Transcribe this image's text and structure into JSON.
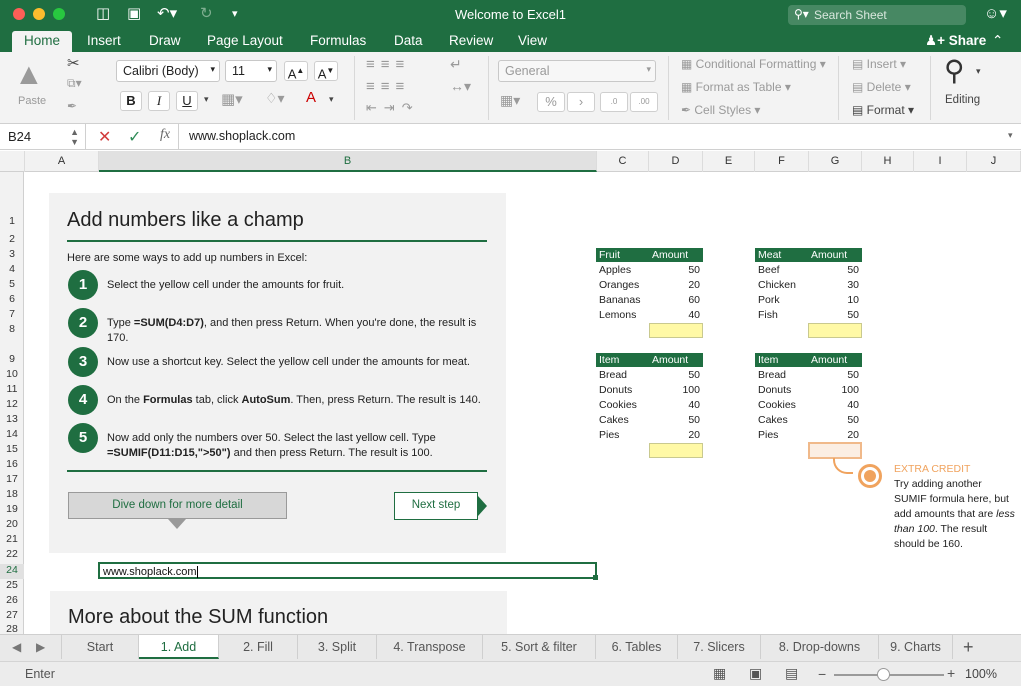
{
  "window": {
    "title": "Welcome to Excel1",
    "search_placeholder": "Search Sheet"
  },
  "ribbon_tabs": [
    "Home",
    "Insert",
    "Draw",
    "Page Layout",
    "Formulas",
    "Data",
    "Review",
    "View"
  ],
  "share_label": "Share",
  "ribbon": {
    "paste_label": "Paste",
    "font_name": "Calibri (Body)",
    "font_size": "11",
    "number_format": "General",
    "conditional_formatting": "Conditional Formatting",
    "format_as_table": "Format as Table",
    "cell_styles": "Cell Styles",
    "insert": "Insert",
    "delete": "Delete",
    "format": "Format",
    "editing": "Editing",
    "bold": "B",
    "italic": "I",
    "underline": "U",
    "percent": "%",
    "fx": "fx"
  },
  "formula_bar": {
    "name_box": "B24",
    "content": "www.shoplack.com"
  },
  "columns": [
    "A",
    "B",
    "C",
    "D",
    "E",
    "F",
    "G",
    "H",
    "I",
    "J"
  ],
  "rows": [
    "1",
    "2",
    "3",
    "4",
    "5",
    "6",
    "7",
    "8",
    "9",
    "10",
    "11",
    "12",
    "13",
    "14",
    "15",
    "16",
    "17",
    "18",
    "19",
    "20",
    "21",
    "22",
    "23",
    "24",
    "25",
    "26",
    "27",
    "28"
  ],
  "lesson": {
    "title": "Add numbers like a champ",
    "intro": "Here are some ways to add up numbers in Excel:",
    "steps": [
      {
        "num": "1",
        "text": "Select the yellow cell under the amounts for fruit."
      },
      {
        "num": "2",
        "pre": "Type ",
        "bold": "=SUM(D4:D7)",
        "post": ", and then press Return. When you're done, the result is 170."
      },
      {
        "num": "3",
        "text": "Now use a shortcut key. Select the yellow cell under the amounts for meat."
      },
      {
        "num": "4",
        "pre": "On the ",
        "bold": "Formulas",
        "mid": " tab, click ",
        "bold2": "AutoSum",
        "post": ". Then, press Return. The result is 140."
      },
      {
        "num": "5",
        "pre": "Now add only the numbers over 50. Select the last yellow cell. Type ",
        "bold": "=SUMIF(D11:D15,\">50\")",
        "post": " and then press Return. The result is 100."
      }
    ],
    "dive_button": "Dive down for more detail",
    "next_button": "Next step",
    "more_title": "More about the SUM function"
  },
  "active_cell_value": "www.shoplack.com",
  "tables": [
    {
      "h1": "Fruit",
      "h2": "Amount",
      "rows": [
        [
          "Apples",
          "50"
        ],
        [
          "Oranges",
          "20"
        ],
        [
          "Bananas",
          "60"
        ],
        [
          "Lemons",
          "40"
        ]
      ]
    },
    {
      "h1": "Meat",
      "h2": "Amount",
      "rows": [
        [
          "Beef",
          "50"
        ],
        [
          "Chicken",
          "30"
        ],
        [
          "Pork",
          "10"
        ],
        [
          "Fish",
          "50"
        ]
      ]
    },
    {
      "h1": "Item",
      "h2": "Amount",
      "rows": [
        [
          "Bread",
          "50"
        ],
        [
          "Donuts",
          "100"
        ],
        [
          "Cookies",
          "40"
        ],
        [
          "Cakes",
          "50"
        ],
        [
          "Pies",
          "20"
        ]
      ]
    },
    {
      "h1": "Item",
      "h2": "Amount",
      "rows": [
        [
          "Bread",
          "50"
        ],
        [
          "Donuts",
          "100"
        ],
        [
          "Cookies",
          "40"
        ],
        [
          "Cakes",
          "50"
        ],
        [
          "Pies",
          "20"
        ]
      ]
    }
  ],
  "extra_credit": {
    "title": "EXTRA CREDIT",
    "pre": "Try adding another SUMIF formula here, but add amounts that are ",
    "italic": "less than 100",
    "post": ". The result should be 160."
  },
  "sheet_tabs": [
    "Start",
    "1. Add",
    "2. Fill",
    "3. Split",
    "4. Transpose",
    "5. Sort & filter",
    "6. Tables",
    "7. Slicers",
    "8. Drop-downs",
    "9. Charts"
  ],
  "status": {
    "mode": "Enter",
    "zoom": "100%"
  },
  "colors": {
    "accent": "#1f6e41",
    "yellow_cell": "#fff9a6",
    "extra_credit": "#f0a35e"
  }
}
